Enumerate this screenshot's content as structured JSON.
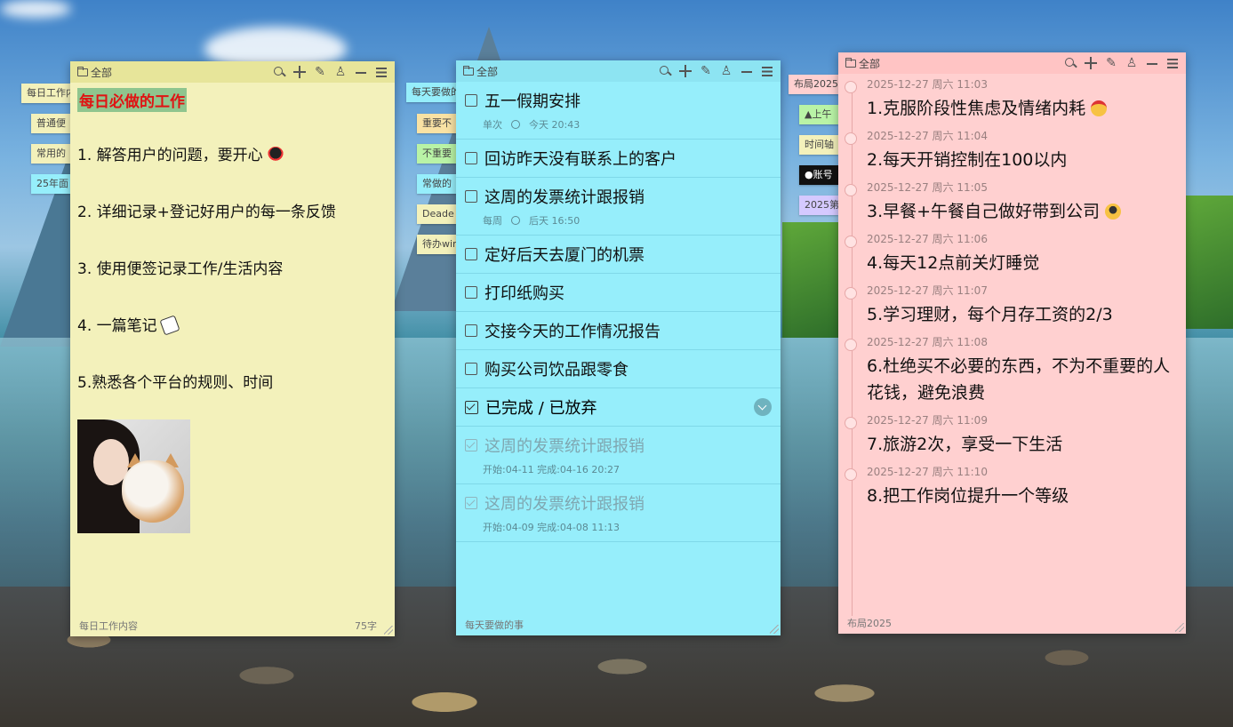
{
  "side_tabs_left": [
    {
      "label": "每日工作内",
      "color": "#f3f1bb"
    },
    {
      "label": "普通便",
      "color": "#f3f1bb"
    },
    {
      "label": "常用的",
      "color": "#f3f1bb"
    },
    {
      "label": "25年面",
      "color": "#96eefb"
    }
  ],
  "side_tabs_mid": [
    {
      "label": "每天要做的",
      "color": "#96eefb"
    },
    {
      "label": "重要不",
      "color": "#f9e2a4"
    },
    {
      "label": "不重要",
      "color": "#b9f3a6"
    },
    {
      "label": "常做的",
      "color": "#96eefb"
    },
    {
      "label": "Deade",
      "color": "#f3f1bb"
    },
    {
      "label": "待办win",
      "color": "#f3f1bb"
    }
  ],
  "side_tabs_right": [
    {
      "label": "布局2025",
      "color": "#ffd0d0"
    },
    {
      "label": "▲上午",
      "color": "#b9f3a6"
    },
    {
      "label": "时间轴",
      "color": "#f3f1bb"
    },
    {
      "label": "账号",
      "color": "#111111"
    },
    {
      "label": "2025第",
      "color": "#d5c9ff"
    }
  ],
  "note1": {
    "category": "全部",
    "title": "每日必做的工作",
    "lines": [
      "1. 解答用户的问题，要开心",
      "2. 详细记录+登记好用户的每一条反馈",
      "3. 使用便签记录工作/生活内容",
      "4. 一篇笔记",
      "5.熟悉各个平台的规则、时间"
    ],
    "footer_name": "每日工作内容",
    "footer_count": "75字"
  },
  "note2": {
    "category": "全部",
    "todos": [
      {
        "text": "五一假期安排",
        "repeat": "单次",
        "time": "今天 20:43"
      },
      {
        "text": "回访昨天没有联系上的客户"
      },
      {
        "text": "这周的发票统计跟报销",
        "repeat": "每周",
        "time": "后天 16:50"
      },
      {
        "text": "定好后天去厦门的机票"
      },
      {
        "text": "打印纸购买"
      },
      {
        "text": "交接今天的工作情况报告"
      },
      {
        "text": "购买公司饮品跟零食"
      }
    ],
    "done_header": "已完成 / 已放弃",
    "done": [
      {
        "text": "这周的发票统计跟报销",
        "meta": "开始:04-11  完成:04-16 20:27"
      },
      {
        "text": "这周的发票统计跟报销",
        "meta": "开始:04-09  完成:04-08 11:13"
      }
    ],
    "footer_name": "每天要做的事"
  },
  "note3": {
    "category": "全部",
    "entries": [
      {
        "date": "2025-12-27 周六 11:03",
        "text": "1.克服阶段性焦虑及情绪内耗"
      },
      {
        "date": "2025-12-27 周六 11:04",
        "text": "2.每天开销控制在100以内"
      },
      {
        "date": "2025-12-27 周六 11:05",
        "text": "3.早餐+午餐自己做好带到公司"
      },
      {
        "date": "2025-12-27 周六 11:06",
        "text": "4.每天12点前关灯睡觉"
      },
      {
        "date": "2025-12-27 周六 11:07",
        "text": "5.学习理财，每个月存工资的2/3"
      },
      {
        "date": "2025-12-27 周六 11:08",
        "text": "6.杜绝买不必要的东西，不为不重要的人花钱，避免浪费"
      },
      {
        "date": "2025-12-27 周六 11:09",
        "text": "7.旅游2次，享受一下生活"
      },
      {
        "date": "2025-12-27 周六 11:10",
        "text": "8.把工作岗位提升一个等级"
      }
    ],
    "footer_name": "布局2025"
  }
}
